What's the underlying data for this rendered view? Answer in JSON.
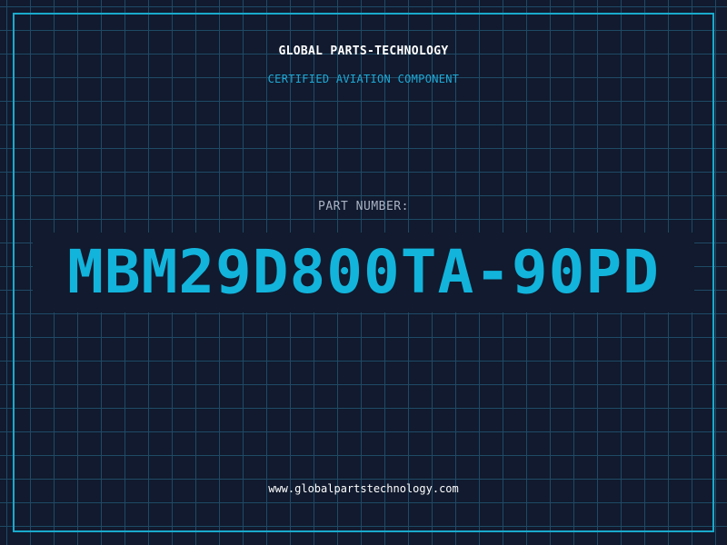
{
  "header": {
    "company": "GLOBAL PARTS-TECHNOLOGY",
    "tagline": "CERTIFIED AVIATION COMPONENT"
  },
  "part": {
    "label": "PART NUMBER:",
    "number": "MBM29D800TA-90PD"
  },
  "footer": {
    "website": "www.globalpartstechnology.com"
  },
  "colors": {
    "background": "#111a2e",
    "grid": "#1f4a66",
    "accent": "#19aacc",
    "text": "#ffffff",
    "muted": "#a9b3c4"
  }
}
